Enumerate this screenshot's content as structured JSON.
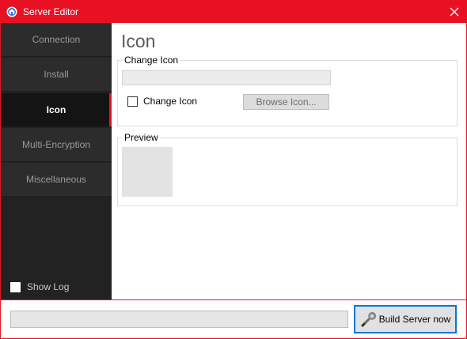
{
  "window": {
    "title": "Server Editor",
    "accent_color": "#e81123",
    "app_icon": "server-app-icon",
    "close_icon": "close-icon"
  },
  "sidebar": {
    "items": [
      {
        "label": "Connection",
        "active": false
      },
      {
        "label": "Install",
        "active": false
      },
      {
        "label": "Icon",
        "active": true
      },
      {
        "label": "Multi-Encryption",
        "active": false
      },
      {
        "label": "Miscellaneous",
        "active": false
      }
    ],
    "show_log": {
      "label": "Show Log",
      "checked": false
    }
  },
  "main": {
    "title": "Icon",
    "change_icon_group": {
      "label": "Change Icon",
      "path_value": "",
      "checkbox_label": "Change Icon",
      "checkbox_checked": false,
      "browse_label": "Browse Icon..."
    },
    "preview_group": {
      "label": "Preview"
    }
  },
  "footer": {
    "progress": 0,
    "build_label": "Build Server now",
    "build_icon": "wrench-icon"
  }
}
